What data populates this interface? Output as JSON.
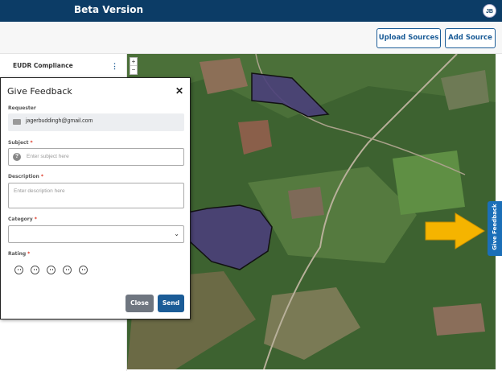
{
  "app": {
    "title": "Beta Version",
    "user_initials": "JB"
  },
  "toolbar": {
    "upload_sources_label": "Upload Sources",
    "add_source_label": "Add Source"
  },
  "sidebar": {
    "items": [
      {
        "label": "EUDR Compliance",
        "menu_icon": "kebab-icon"
      }
    ]
  },
  "map": {
    "zoom_in": "+",
    "zoom_out": "−",
    "polygon_fill": "#4a3f7a"
  },
  "feedback_tab": {
    "label": "Give Feedback"
  },
  "feedback_modal": {
    "title": "Give Feedback",
    "close_glyph": "✕",
    "requester": {
      "label": "Requester",
      "value": "jagerbuddingh@gmail.com"
    },
    "subject": {
      "label": "Subject",
      "required_mark": "*",
      "placeholder": "Enter subject here"
    },
    "description": {
      "label": "Description",
      "required_mark": "*",
      "placeholder": "Enter description here"
    },
    "category": {
      "label": "Category",
      "required_mark": "*",
      "value": ""
    },
    "rating": {
      "label": "Rating",
      "required_mark": "*",
      "options": [
        "very-sad",
        "sad",
        "neutral",
        "happy",
        "very-happy"
      ]
    },
    "close_label": "Close",
    "send_label": "Send"
  },
  "colors": {
    "header": "#0c3c66",
    "primary": "#1b5c97",
    "close_button": "#6f7680",
    "arrow": "#f5b400"
  }
}
